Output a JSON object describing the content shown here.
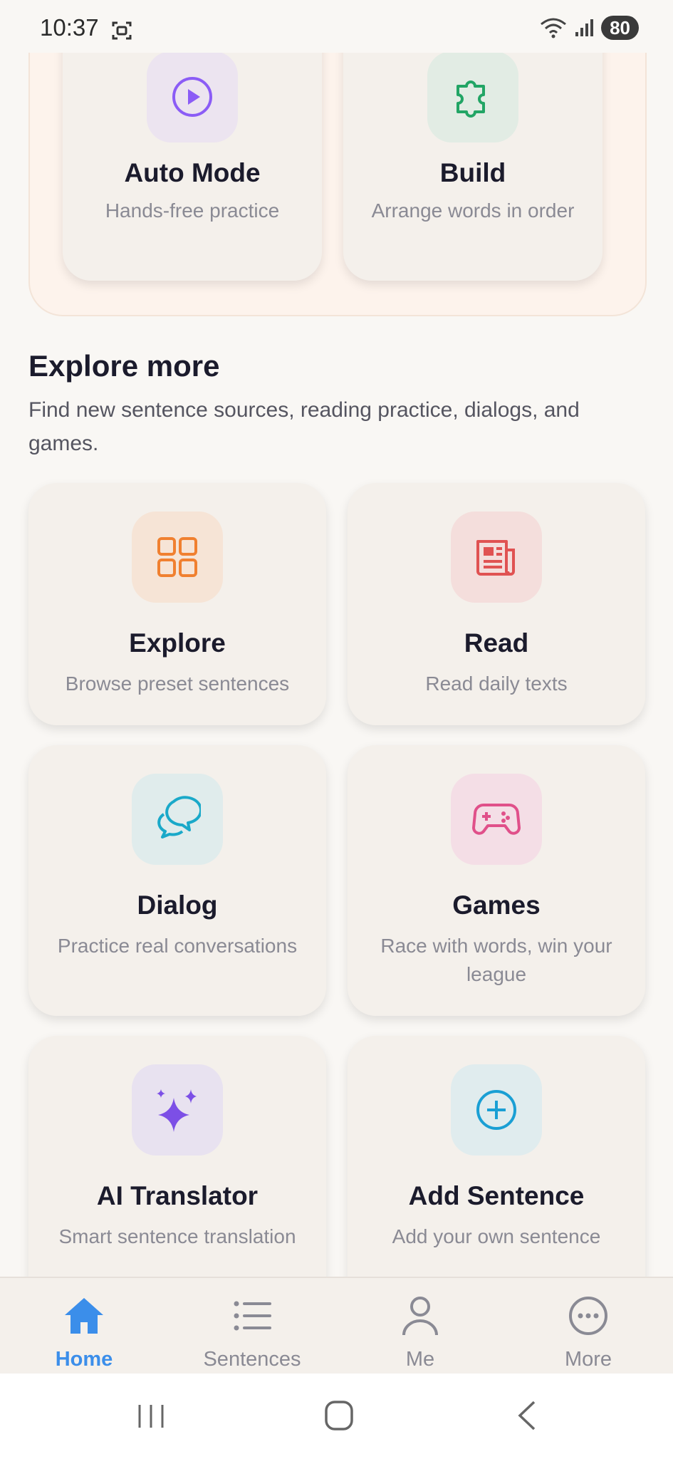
{
  "status_bar": {
    "time": "10:37",
    "battery": "80"
  },
  "top_cards": [
    {
      "title": "Auto Mode",
      "subtitle": "Hands-free practice",
      "icon": "play-circle-icon",
      "icon_bg": "#ece4f0",
      "icon_color": "#8b5cf6"
    },
    {
      "title": "Build",
      "subtitle": "Arrange words in order",
      "icon": "puzzle-icon",
      "icon_bg": "#e2ece4",
      "icon_color": "#22a565"
    }
  ],
  "explore": {
    "title": "Explore more",
    "description": "Find new sentence sources, reading practice, dialogs, and games.",
    "cards": [
      {
        "title": "Explore",
        "subtitle": "Browse preset sentences",
        "icon": "grid-icon",
        "icon_bg": "#f6e4d6",
        "icon_color": "#f08030"
      },
      {
        "title": "Read",
        "subtitle": "Read daily texts",
        "icon": "newspaper-icon",
        "icon_bg": "#f4dedc",
        "icon_color": "#e05252"
      },
      {
        "title": "Dialog",
        "subtitle": "Practice real conversations",
        "icon": "chat-bubbles-icon",
        "icon_bg": "#e0ecec",
        "icon_color": "#1aa9c9"
      },
      {
        "title": "Games",
        "subtitle": "Race with words, win your league",
        "icon": "gamepad-icon",
        "icon_bg": "#f4dee6",
        "icon_color": "#e0508a"
      },
      {
        "title": "AI Translator",
        "subtitle": "Smart sentence translation",
        "icon": "sparkles-icon",
        "icon_bg": "#e8e2f0",
        "icon_color": "#7c4fe6"
      },
      {
        "title": "Add Sentence",
        "subtitle": "Add your own sentence",
        "icon": "plus-circle-icon",
        "icon_bg": "#e0ecee",
        "icon_color": "#1a9fd4"
      }
    ]
  },
  "bottom_nav": [
    {
      "label": "Home",
      "icon": "home-icon",
      "active": true
    },
    {
      "label": "Sentences",
      "icon": "list-icon",
      "active": false
    },
    {
      "label": "Me",
      "icon": "user-icon",
      "active": false
    },
    {
      "label": "More",
      "icon": "more-icon",
      "active": false
    }
  ],
  "colors": {
    "accent": "#3b8eea",
    "muted": "#8a8a94",
    "card_bg": "#f4f0eb"
  }
}
